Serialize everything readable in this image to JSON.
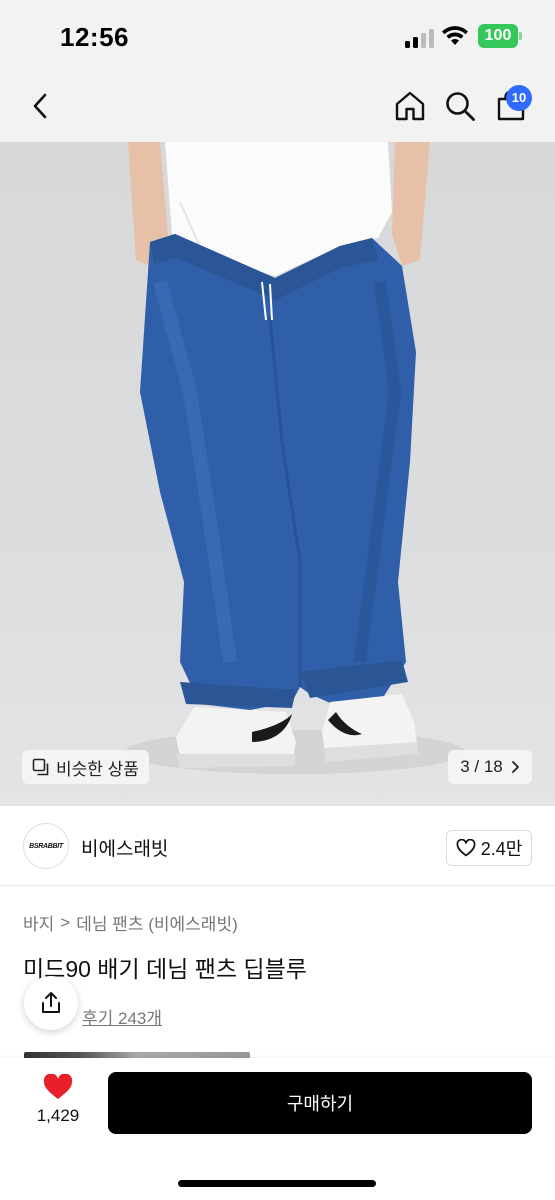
{
  "status_bar": {
    "time": "12:56",
    "battery": "100"
  },
  "nav": {
    "back_icon": "chevron-left-icon",
    "home_icon": "home-icon",
    "search_icon": "search-icon",
    "cart_icon": "cart-icon",
    "cart_count": "10"
  },
  "hero": {
    "similar_label": "비슷한 상품",
    "page_counter": "3 / 18"
  },
  "brand": {
    "name": "비에스래빗",
    "logo_text": "BSRABBIT",
    "likes": "2.4만"
  },
  "product": {
    "breadcrumb": [
      "바지",
      "데님 팬츠 (비에스래빗)"
    ],
    "title": "미드90 배기 데님 팬츠 딥블루",
    "review_label": "후기 243개"
  },
  "bottom": {
    "like_count": "1,429",
    "buy_label": "구매하기"
  },
  "colors": {
    "accent_blue": "#2f6bff",
    "heart_red": "#e8202a",
    "buy_bg": "#000000",
    "battery_green": "#34c759"
  }
}
